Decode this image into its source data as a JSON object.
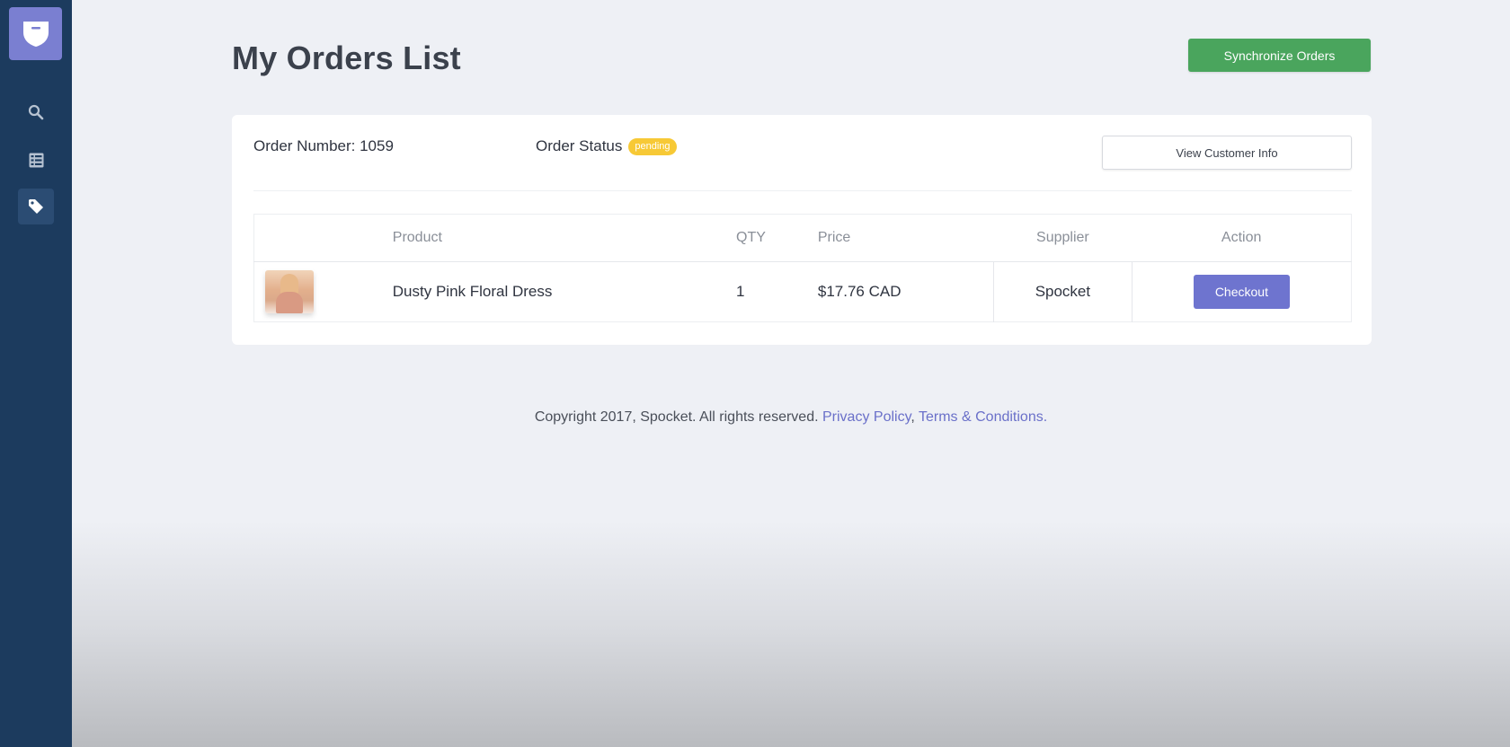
{
  "sidebar": {
    "logo_icon": "shield-logo-icon",
    "items": [
      {
        "icon": "search-icon",
        "active": false
      },
      {
        "icon": "list-icon",
        "active": false
      },
      {
        "icon": "tag-icon",
        "active": true
      }
    ]
  },
  "header": {
    "title": "My Orders List",
    "sync_button_label": "Synchronize Orders"
  },
  "order": {
    "number_label": "Order Number: 1059",
    "status_label": "Order Status",
    "status_badge": "pending",
    "view_customer_label": "View Customer Info",
    "table": {
      "columns": [
        "",
        "Product",
        "QTY",
        "Price",
        "Supplier",
        "Action"
      ],
      "rows": [
        {
          "product": "Dusty Pink Floral Dress",
          "qty": "1",
          "price": "$17.76 CAD",
          "supplier": "Spocket",
          "action_label": "Checkout"
        }
      ]
    }
  },
  "footer": {
    "copyright": "Copyright 2017, Spocket. All rights reserved.",
    "privacy_link": "Privacy Policy",
    "separator": ",",
    "terms_link": "Terms & Conditions."
  },
  "colors": {
    "sidebar": "#1c3b5e",
    "logo": "#7a7fd1",
    "sync_button": "#4aa55d",
    "checkout_button": "#6e74cf",
    "status_badge": "#f7c936",
    "link": "#6a70c9"
  }
}
